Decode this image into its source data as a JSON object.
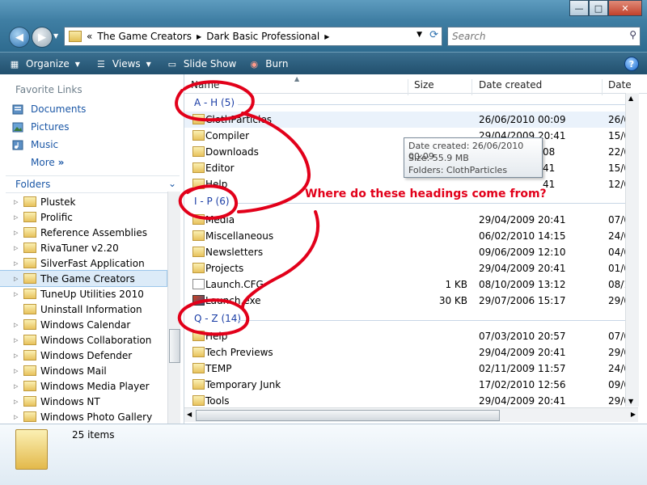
{
  "window": {
    "controls": {
      "minimize": "—",
      "maximize": "□",
      "close": "✕"
    }
  },
  "address": {
    "overflow": "«",
    "crumbs": [
      "The Game Creators",
      "Dark Basic Professional"
    ]
  },
  "search": {
    "placeholder": "Search"
  },
  "toolbar": {
    "organize": "Organize",
    "views": "Views",
    "slideshow": "Slide Show",
    "burn": "Burn",
    "help": "?"
  },
  "nav": {
    "favorites_title": "Favorite Links",
    "favorites": [
      "Documents",
      "Pictures",
      "Music"
    ],
    "more": "More",
    "folders_title": "Folders",
    "tree": [
      "Plustek",
      "Prolific",
      "Reference Assemblies",
      "RivaTuner v2.20",
      "SilverFast Application",
      "The Game Creators",
      "TuneUp Utilities 2010",
      "Uninstall Information",
      "Windows Calendar",
      "Windows Collaboration",
      "Windows Defender",
      "Windows Mail",
      "Windows Media Player",
      "Windows NT",
      "Windows Photo Gallery"
    ],
    "selected": "The Game Creators"
  },
  "columns": {
    "name": "Name",
    "size": "Size",
    "date_created": "Date created",
    "date_modified": "Date"
  },
  "groups": [
    {
      "label": "A - H (5)"
    },
    {
      "label": "I - P (6)"
    },
    {
      "label": "Q - Z (14)"
    }
  ],
  "rows": [
    {
      "name": "ClothParticles",
      "size": "",
      "created": "26/06/2010 00:09",
      "modified": "26/0"
    },
    {
      "name": "Compiler",
      "size": "",
      "created": "29/04/2009 20:41",
      "modified": "15/0"
    },
    {
      "name": "Downloads",
      "size": "",
      "created": "08",
      "modified": "22/0"
    },
    {
      "name": "Editor",
      "size": "",
      "created": "41",
      "modified": "15/0"
    },
    {
      "name": "Help",
      "size": "",
      "created": "41",
      "modified": "12/0"
    },
    {
      "name": "Media",
      "size": "",
      "created": "29/04/2009 20:41",
      "modified": "07/0"
    },
    {
      "name": "Miscellaneous",
      "size": "",
      "created": "06/02/2010 14:15",
      "modified": "24/0"
    },
    {
      "name": "Newsletters",
      "size": "",
      "created": "09/06/2009 12:10",
      "modified": "04/0"
    },
    {
      "name": "Projects",
      "size": "",
      "created": "29/04/2009 20:41",
      "modified": "01/0"
    },
    {
      "name": "Launch.CFG",
      "size": "1 KB",
      "created": "08/10/2009 13:12",
      "modified": "08/1"
    },
    {
      "name": "Launch.exe",
      "size": "30 KB",
      "created": "29/07/2006 15:17",
      "modified": "29/0"
    },
    {
      "name": "Help",
      "size": "",
      "created": "07/03/2010 20:57",
      "modified": "07/0"
    },
    {
      "name": "Tech Previews",
      "size": "",
      "created": "29/04/2009 20:41",
      "modified": "29/0"
    },
    {
      "name": "TEMP",
      "size": "",
      "created": "02/11/2009 11:57",
      "modified": "24/0"
    },
    {
      "name": "Temporary Junk",
      "size": "",
      "created": "17/02/2010 12:56",
      "modified": "09/0"
    },
    {
      "name": "Tools",
      "size": "",
      "created": "29/04/2009 20:41",
      "modified": "29/0"
    }
  ],
  "tooltip": {
    "line1": "Date created: 26/06/2010 00:09",
    "line2": "Size: 55.9 MB",
    "line3": "Folders: ClothParticles"
  },
  "annotation": {
    "text": "Where do these headings come from?",
    "color": "#e2001a"
  },
  "details": {
    "count": "25 items"
  }
}
